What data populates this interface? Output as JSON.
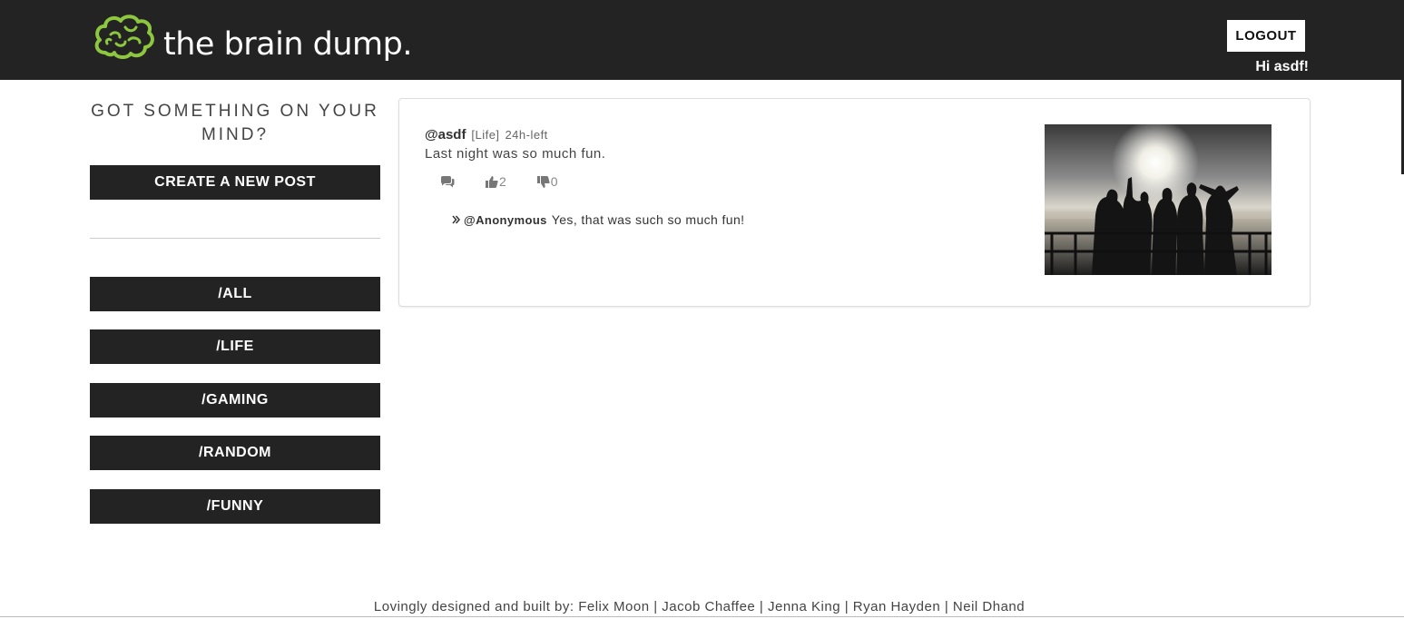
{
  "header": {
    "logo_text": "the brain dump.",
    "logo_icon": "brain-icon",
    "logout_label": "LOGOUT",
    "greeting": "Hi asdf!"
  },
  "sidebar": {
    "heading": "GOT SOMETHING ON YOUR MIND?",
    "create_label": "CREATE A NEW POST",
    "categories": [
      {
        "label": "/ALL"
      },
      {
        "label": "/LIFE"
      },
      {
        "label": "/GAMING"
      },
      {
        "label": "/RANDOM"
      },
      {
        "label": "/FUNNY"
      }
    ]
  },
  "post": {
    "author": "@asdf",
    "tag": "[Life]",
    "time_left": "24h-left",
    "body": "Last night was so much fun.",
    "likes": "2",
    "dislikes": "0",
    "comment": {
      "author": "@Anonymous",
      "text": "Yes, that was such so much fun!"
    }
  },
  "footer": {
    "credits": "Lovingly designed and built by: Felix Moon | Jacob Chaffee | Jenna King | Ryan Hayden | Neil Dhand"
  },
  "colors": {
    "header_bg": "#232323",
    "brand_green": "#8dc63f",
    "button_bg": "#232323"
  }
}
